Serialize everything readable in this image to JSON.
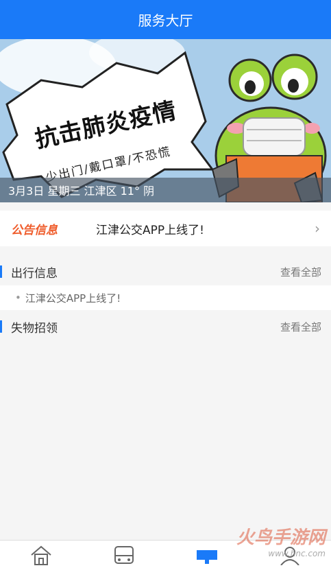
{
  "header": {
    "title": "服务大厅"
  },
  "banner": {
    "headline": "抗击肺炎疫情",
    "subline": "少出门/戴口罩/不恐慌",
    "date_weather": "3月3日 星期三 江津区 11° 阴"
  },
  "notice": {
    "label": "公告信息",
    "text": "江津公交APP上线了!"
  },
  "travel": {
    "title": "出行信息",
    "view_all": "查看全部",
    "items": [
      "江津公交APP上线了!"
    ]
  },
  "lost_found": {
    "title": "失物招领",
    "view_all": "查看全部"
  },
  "tabs": [
    {
      "icon": "home-icon"
    },
    {
      "icon": "bus-icon"
    },
    {
      "icon": "service-hall-icon",
      "active": true
    },
    {
      "icon": "profile-icon"
    }
  ],
  "colors": {
    "primary": "#1a7af8",
    "notice_label": "#ef5b2a"
  },
  "watermark": {
    "text": "火鸟手游网",
    "url": "www.hnc.com"
  }
}
